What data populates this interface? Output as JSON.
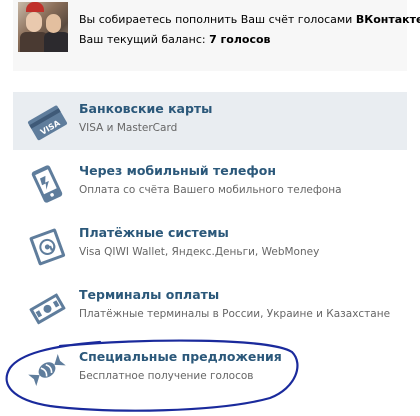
{
  "header": {
    "line1_prefix": "Вы собираетесь пополнить Ваш счёт голосами ",
    "line1_brand": "ВКонтакте",
    "line1_suffix": ".",
    "line2_prefix": "Ваш текущий баланс: ",
    "line2_balance": "7 голосов"
  },
  "options": [
    {
      "title": "Банковские карты",
      "subtitle": "VISA и MasterCard",
      "icon": "bank-card-icon",
      "card_text": "VISA"
    },
    {
      "title": "Через мобильный телефон",
      "subtitle": "Оплата со счёта Вашего мобильного телефона",
      "icon": "mobile-phone-icon"
    },
    {
      "title": "Платёжные системы",
      "subtitle": "Visa QIWI Wallet, Яндекс.Деньги, WebMoney",
      "icon": "payment-systems-icon"
    },
    {
      "title": "Терминалы оплаты",
      "subtitle": "Платёжные терминалы в России, Украине и Казахстане",
      "icon": "payment-terminal-icon"
    },
    {
      "title": "Специальные предложения",
      "subtitle": "Бесплатное получение голосов",
      "icon": "candy-icon"
    }
  ],
  "colors": {
    "link": "#2b587a",
    "icon": "#5f7d9c",
    "selected_bg": "#e9edf1",
    "header_bg": "#f7f7f7",
    "annotation": "#1a2a9c"
  }
}
